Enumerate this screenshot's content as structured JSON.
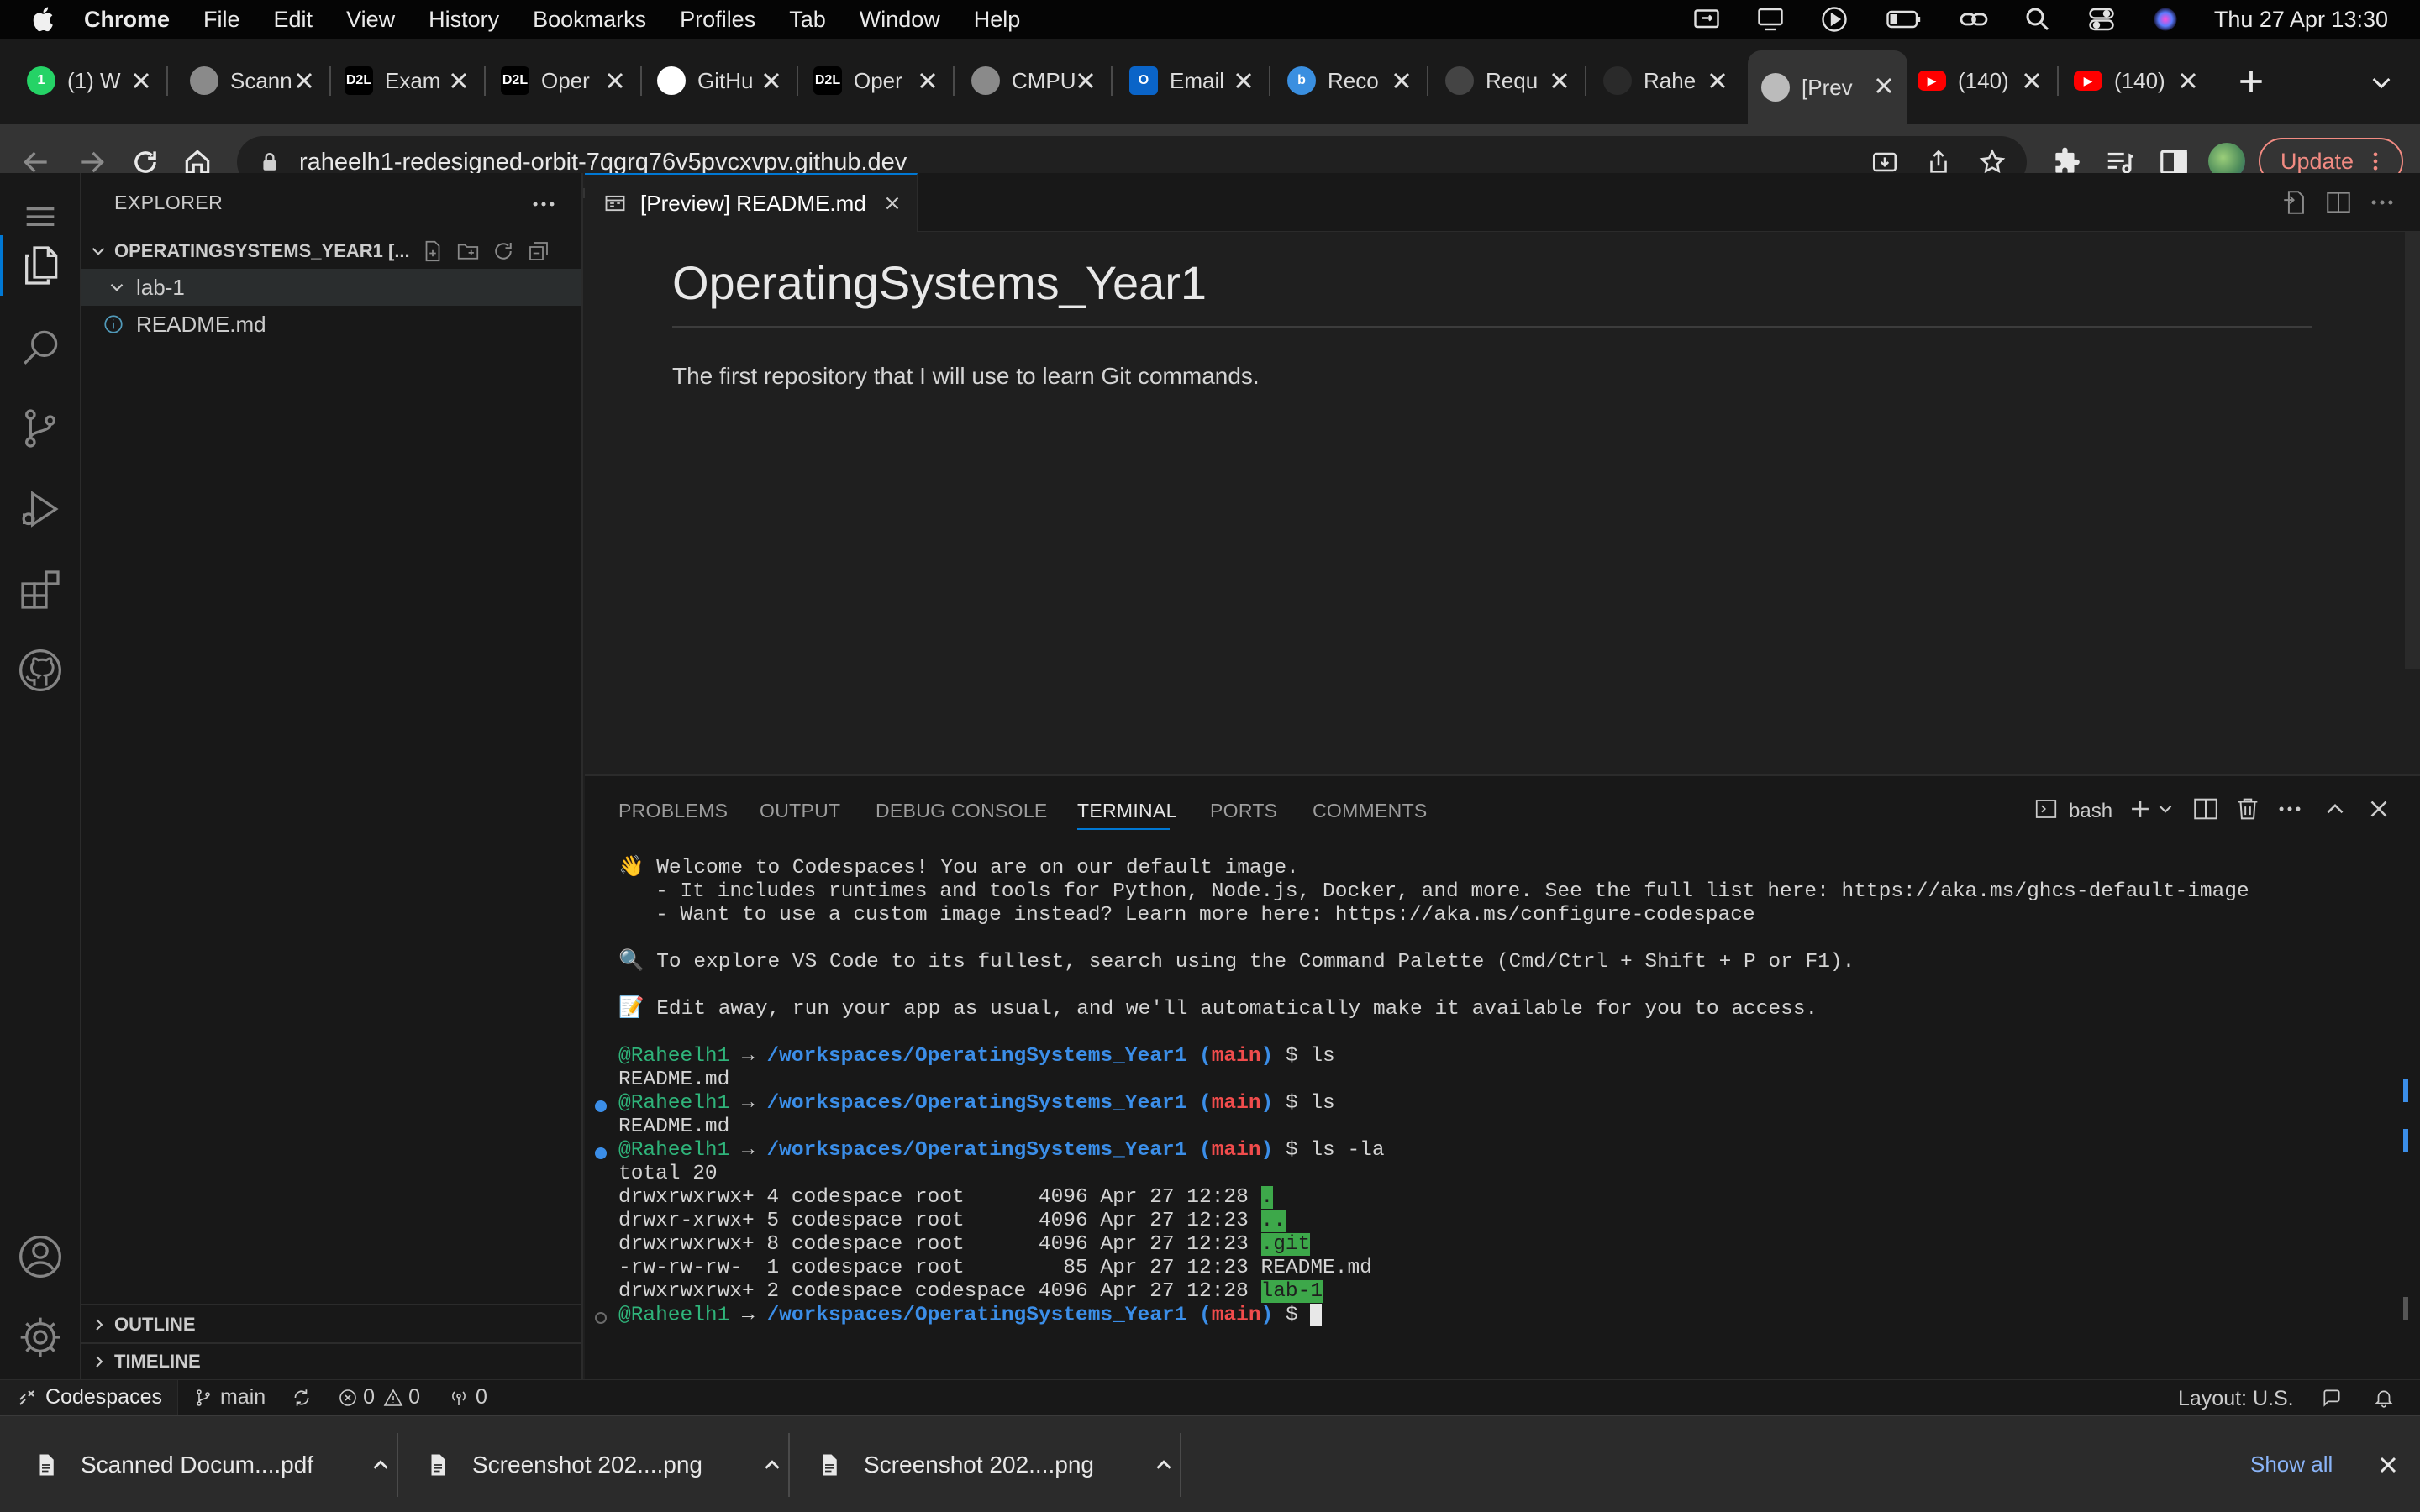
{
  "menubar": {
    "app": "Chrome",
    "menus": [
      "File",
      "Edit",
      "View",
      "History",
      "Bookmarks",
      "Profiles",
      "Tab",
      "Window",
      "Help"
    ],
    "datetime": "Thu 27 Apr  13:30"
  },
  "tabs": [
    {
      "title": "(1) W",
      "icon": "whatsapp-icon",
      "badge": "1",
      "color": "#25d366"
    },
    {
      "title": "Scann",
      "icon": "globe-icon",
      "color": "#8a8a8a"
    },
    {
      "title": "Exam",
      "icon": "d2l-icon",
      "badge": "D2L",
      "color": "#000000"
    },
    {
      "title": "Oper",
      "icon": "d2l-icon",
      "badge": "D2L",
      "color": "#000000"
    },
    {
      "title": "GitHu",
      "icon": "github-icon",
      "color": "#ffffff"
    },
    {
      "title": "Oper",
      "icon": "d2l-icon",
      "badge": "D2L",
      "color": "#000000"
    },
    {
      "title": "CMPU",
      "icon": "globe-icon",
      "color": "#8a8a8a"
    },
    {
      "title": "Email",
      "icon": "outlook-icon",
      "badge": "O",
      "color": "#0a64c8"
    },
    {
      "title": "Reco",
      "icon": "bing-icon",
      "badge": "b",
      "color": "#3a8fe0"
    },
    {
      "title": "Requ",
      "icon": "github-icon",
      "color": "#444444"
    },
    {
      "title": "Rahe",
      "icon": "github-icon",
      "color": "#2a2a2a"
    },
    {
      "title": "[Prev",
      "icon": "github-icon",
      "color": "#bbbbbb"
    },
    {
      "title": "(140)",
      "icon": "youtube-icon",
      "color": "#ff0000"
    },
    {
      "title": "(140)",
      "icon": "youtube-icon",
      "color": "#ff0000"
    }
  ],
  "omnibox": {
    "url": "raheelh1-redesigned-orbit-7qgrq76v5pvcxvpv.github.dev"
  },
  "update_label": "Update",
  "explorer": {
    "title": "EXPLORER",
    "root": "OPERATINGSYSTEMS_YEAR1 [...",
    "folder": "lab-1",
    "file": "README.md",
    "outline": "OUTLINE",
    "timeline": "TIMELINE"
  },
  "editor": {
    "tab_label": "[Preview] README.md",
    "heading": "OperatingSystems_Year1",
    "paragraph": "The first repository that I will use to learn Git commands."
  },
  "panel": {
    "tabs": [
      "PROBLEMS",
      "OUTPUT",
      "DEBUG CONSOLE",
      "TERMINAL",
      "PORTS",
      "COMMENTS"
    ],
    "shell": "bash"
  },
  "terminal": {
    "welcome": "👋 Welcome to Codespaces! You are on our default image.",
    "bullet1": "   - It includes runtimes and tools for Python, Node.js, Docker, and more. See the full list here: https://aka.ms/ghcs-default-image",
    "bullet2": "   - Want to use a custom image instead? Learn more here: https://aka.ms/configure-codespace",
    "explore": "🔍 To explore VS Code to its fullest, search using the Command Palette (Cmd/Ctrl + Shift + P or F1).",
    "edit": "📝 Edit away, run your app as usual, and we'll automatically make it available for you to access.",
    "user": "@Raheelh1",
    "arrow": " → ",
    "path": "/workspaces/OperatingSystems_Year1",
    "branch_open": " (",
    "branch": "main",
    "branch_close": ")",
    "dollar": " $ ",
    "cmd1": "ls",
    "out1": "README.md",
    "cmd2": "ls",
    "out2": "README.md",
    "cmd3": "ls -la",
    "total": "total 20",
    "rows": [
      {
        "meta": "drwxrwxrwx+ 4 codespace root      4096 Apr 27 12:28 ",
        "name": ".",
        "hl": true
      },
      {
        "meta": "drwxr-xrwx+ 5 codespace root      4096 Apr 27 12:23 ",
        "name": "..",
        "hl": true
      },
      {
        "meta": "drwxrwxrwx+ 8 codespace root      4096 Apr 27 12:23 ",
        "name": ".git",
        "hl": true
      },
      {
        "meta": "-rw-rw-rw-  1 codespace root        85 Apr 27 12:23 ",
        "name": "README.md",
        "hl": false
      },
      {
        "meta": "drwxrwxrwx+ 2 codespace codespace 4096 Apr 27 12:28 ",
        "name": "lab-1",
        "hl": true
      }
    ]
  },
  "statusbar": {
    "remote": "Codespaces",
    "branch": "main",
    "errors": "0",
    "warnings": "0",
    "ports": "0",
    "layout": "Layout: U.S."
  },
  "downloads": {
    "items": [
      "Scanned Docum....pdf",
      "Screenshot 202....png",
      "Screenshot 202....png"
    ],
    "show_all": "Show all"
  },
  "colors": {
    "accent_blue": "#0078d4",
    "term_green": "#2fb47a",
    "term_blue": "#3b8ee8",
    "term_red": "#f14c4c",
    "update_red": "#f28b82"
  }
}
